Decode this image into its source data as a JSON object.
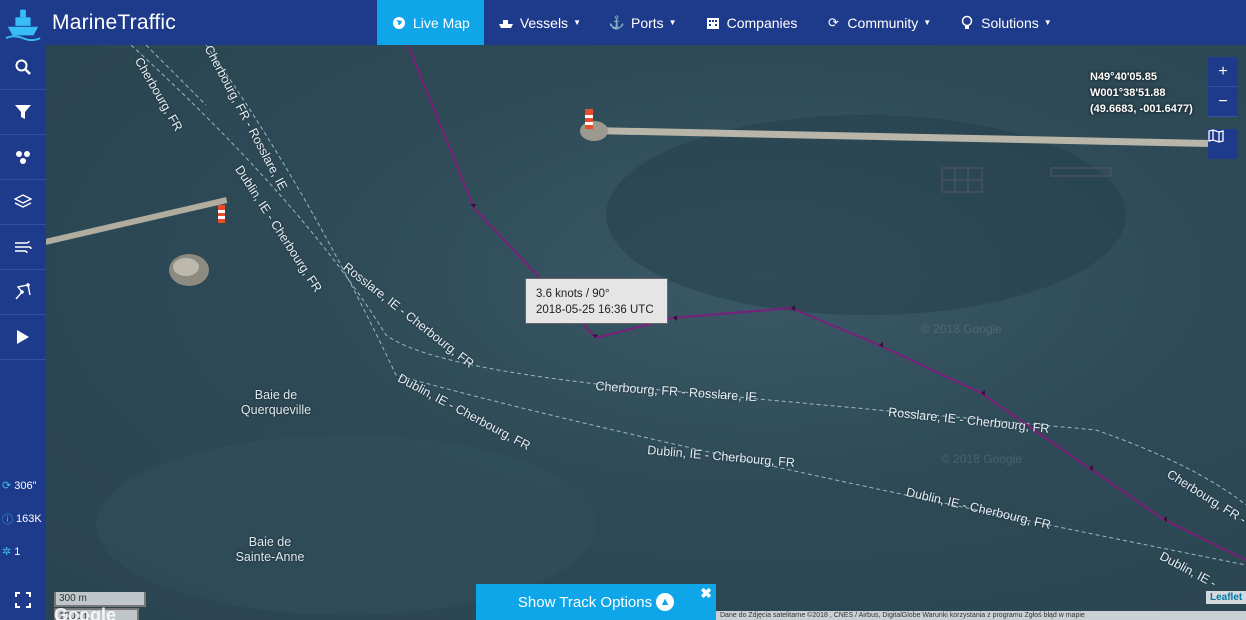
{
  "brand": {
    "name": "MarineTraffic",
    "logo": "ship-logo-icon"
  },
  "nav": [
    {
      "label": "Live Map",
      "icon": "globe-icon",
      "active": true,
      "dropdown": false
    },
    {
      "label": "Vessels",
      "icon": "ship-icon",
      "active": false,
      "dropdown": true
    },
    {
      "label": "Ports",
      "icon": "anchor-icon",
      "active": false,
      "dropdown": true
    },
    {
      "label": "Companies",
      "icon": "building-icon",
      "active": false,
      "dropdown": false
    },
    {
      "label": "Community",
      "icon": "refresh-icon",
      "active": false,
      "dropdown": true
    },
    {
      "label": "Solutions",
      "icon": "lightbulb-icon",
      "active": false,
      "dropdown": true
    }
  ],
  "sidebar": {
    "buttons": [
      "search-icon",
      "filter-icon",
      "fleet-icon",
      "layers-icon",
      "wind-icon",
      "route-icon",
      "play-icon"
    ],
    "stats": [
      {
        "icon": "refresh-icon",
        "value": "306\""
      },
      {
        "icon": "info-icon",
        "value": "163K"
      },
      {
        "icon": "gear-icon",
        "value": "1"
      }
    ]
  },
  "map": {
    "coordinates": {
      "lat": "N49°40'05.85",
      "lon": "W001°38'51.88",
      "decimal": "(49.6683, -001.6477)"
    },
    "tooltip": {
      "speed": "3.6 knots / 90°",
      "timestamp": "2018-05-25 16:36 UTC"
    },
    "route_labels": [
      "Cherbourg, FR",
      "Cherbourg, FR - Rosslare, IE",
      "Dublin, IE - Cherbourg, FR",
      "Rosslare, IE - Cherbourg, FR",
      "Dublin, IE - Cherbourg, FR",
      "Cherbourg, FR - Rosslare, IE",
      "Dublin, IE - Cherbourg, FR",
      "Rosslare, IE - Cherbourg, FR",
      "Dublin, IE - Cherbourg, FR",
      "Cherbourg, FR -",
      "Dublin, IE -"
    ],
    "places": [
      "Baie de Querqueville",
      "Baie de Sainte-Anne"
    ],
    "scale": {
      "top": "300 m",
      "bottom": "1000 ft"
    },
    "attribution": "Dane do Zdjęcia satelitarne ©2018 , CNES / Airbus, DigitalGlobe   Warunki korzystania z programu   Zgłoś błąd w mapie",
    "leaflet": "Leaflet",
    "watermark": "© 2018 Google",
    "google": "Google"
  },
  "track_options": {
    "label": "Show Track Options"
  },
  "colors": {
    "brand": "#1e3a8a",
    "accent": "#0ea5e9",
    "track": "#7b1f7a",
    "sea": "#2f4a5a"
  }
}
